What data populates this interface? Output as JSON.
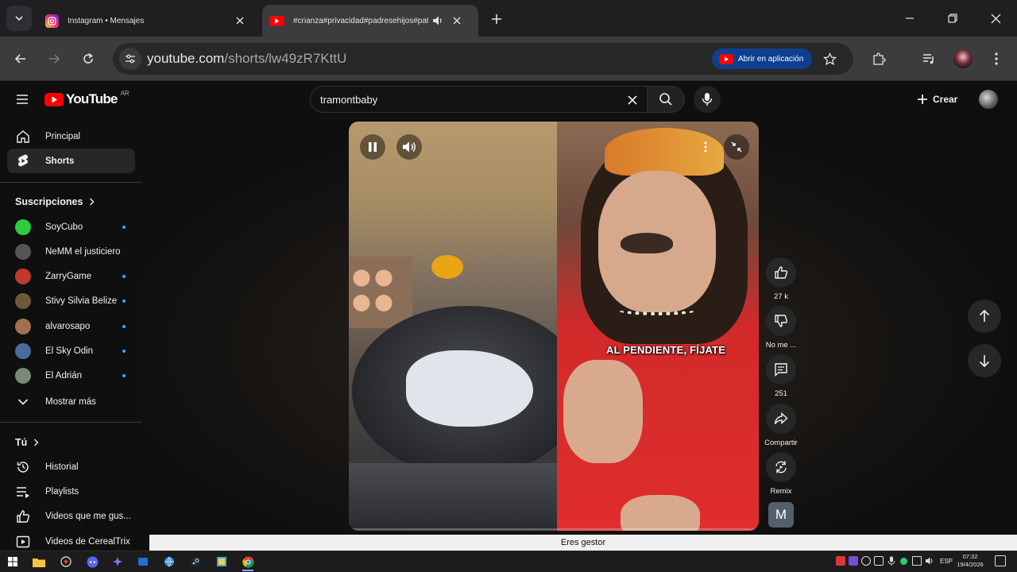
{
  "browser": {
    "tabs": [
      {
        "title": "Instagram • Mensajes",
        "active": false
      },
      {
        "title": "#crianza#privacidad#padresehijos#paternidad#...",
        "active": true
      }
    ],
    "url_host": "youtube.com",
    "url_path": "/shorts/lw49zR7KttU",
    "open_app_label": "Abrir en aplicación"
  },
  "youtube": {
    "logo_text": "YouTube",
    "country_code": "AR",
    "search_query": "tramontbaby",
    "create_label": "Crear"
  },
  "sidebar": {
    "main": [
      {
        "label": "Principal",
        "icon": "home-icon",
        "active": false
      },
      {
        "label": "Shorts",
        "icon": "shorts-icon",
        "active": true
      }
    ],
    "subscriptions_heading": "Suscripciones",
    "subscriptions": [
      {
        "label": "SoyCubo",
        "color": "#2ecc40",
        "new": true
      },
      {
        "label": "NeMM el justiciero",
        "color": "#555555",
        "new": false
      },
      {
        "label": "ZarryGame",
        "color": "#c0392b",
        "new": true
      },
      {
        "label": "Stivy Silvia Belize",
        "color": "#6b5a3a",
        "new": true
      },
      {
        "label": "alvarosapo",
        "color": "#a07050",
        "new": true
      },
      {
        "label": "El Sky Odin",
        "color": "#4a6aa0",
        "new": true
      },
      {
        "label": "El Adrián",
        "color": "#7a8a7a",
        "new": true
      }
    ],
    "show_more": "Mostrar más",
    "you_heading": "Tú",
    "you": [
      {
        "label": "Historial",
        "icon": "history-icon"
      },
      {
        "label": "Playlists",
        "icon": "playlist-icon"
      },
      {
        "label": "Videos que me gus...",
        "icon": "thumbs-up-icon"
      },
      {
        "label": "Videos de CerealTrix",
        "icon": "video-icon"
      }
    ]
  },
  "short": {
    "caption": "AL PENDIENTE, FÍJATE",
    "likes": "27 k",
    "dislike_label": "No me ...",
    "comments": "251",
    "share_label": "Compartir",
    "remix_label": "Remix",
    "sound_initial": "M"
  },
  "tooltip": "Eres gestor",
  "taskbar": {
    "language": "ESP",
    "time": "07:32",
    "date": "19/4/2026"
  }
}
